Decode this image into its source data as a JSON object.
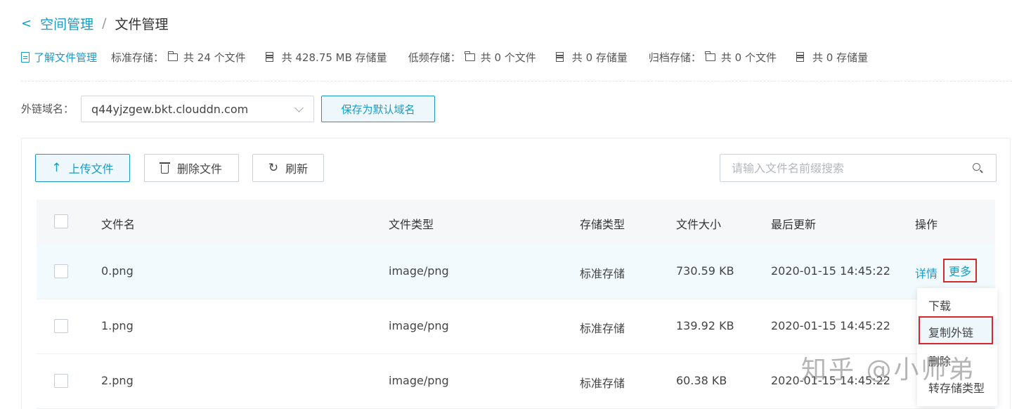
{
  "breadcrumb": {
    "back_icon": "chevron-left-icon",
    "parent": "空间管理",
    "separator": "/",
    "current": "文件管理"
  },
  "stats": {
    "learn_link": "了解文件管理",
    "standard": {
      "label": "标准存储：",
      "files": "共 24 个文件",
      "size": "共 428.75 MB 存储量"
    },
    "infrequent": {
      "label": "低频存储：",
      "files": "共 0 个文件",
      "size": "共 0 存储量"
    },
    "archive": {
      "label": "归档存储：",
      "files": "共 0 个文件",
      "size": "共 0 存储量"
    }
  },
  "domain": {
    "label": "外链域名：",
    "selected": "q44yjzgew.bkt.clouddn.com",
    "save_button": "保存为默认域名"
  },
  "toolbar": {
    "upload": "上传文件",
    "delete": "删除文件",
    "refresh": "刷新",
    "search_placeholder": "请输入文件名前缀搜索"
  },
  "table": {
    "headers": {
      "name": "文件名",
      "type": "文件类型",
      "storage": "存储类型",
      "size": "文件大小",
      "updated": "最后更新",
      "ops": "操作"
    },
    "rows": [
      {
        "name": "0.png",
        "type": "image/png",
        "storage": "标准存储",
        "size": "730.59 KB",
        "updated": "2020-01-15 14:45:22"
      },
      {
        "name": "1.png",
        "type": "image/png",
        "storage": "标准存储",
        "size": "139.92 KB",
        "updated": "2020-01-15 14:45:22"
      },
      {
        "name": "2.png",
        "type": "image/png",
        "storage": "标准存储",
        "size": "60.38 KB",
        "updated": "2020-01-15 14:45:22"
      }
    ],
    "op_detail": "详情",
    "op_more": "更多"
  },
  "dropdown": {
    "items": [
      "下载",
      "复制外链",
      "删除",
      "转存储类型"
    ]
  },
  "watermark": "知乎 @小师弟",
  "colors": {
    "accent": "#1a9bc4",
    "highlight": "#d12a2a"
  }
}
